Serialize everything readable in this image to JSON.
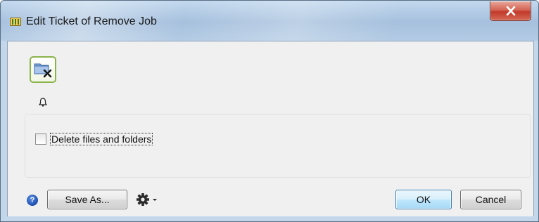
{
  "window": {
    "title": "Edit Ticket of Remove Job",
    "close_label": "X"
  },
  "ticket": {
    "icon": "remove-folder-icon",
    "notification_icon": "bell-icon"
  },
  "options": {
    "delete_files_label": "Delete files and folders",
    "delete_files_checked": false
  },
  "footer": {
    "help_icon": "question-mark",
    "save_as_label": "Save As...",
    "gear_menu_icon": "gear-icon",
    "ok_label": "OK",
    "cancel_label": "Cancel"
  },
  "colors": {
    "titlebar": "#a9c4e0",
    "close_button": "#c1392b",
    "icon_border": "#8ab34a",
    "content_bg": "#f0f0f0"
  }
}
